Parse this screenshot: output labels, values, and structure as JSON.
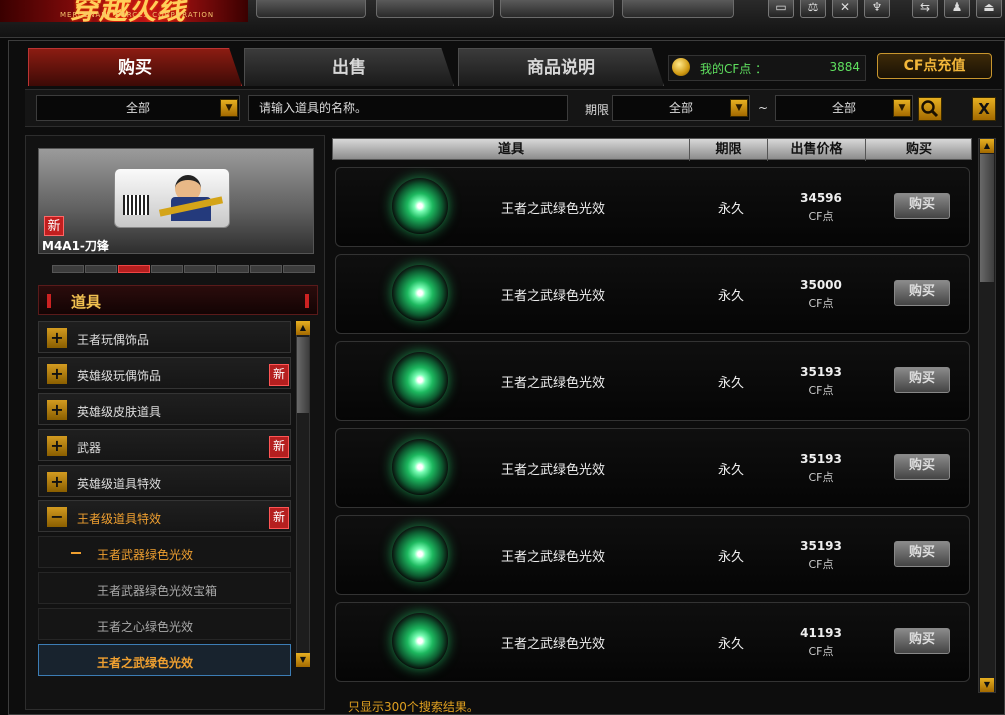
{
  "top": {
    "logo_text": "穿越火线",
    "logo_sub": "MERCENARY FORCES CORPORATION",
    "buttons": [
      "",
      "",
      "",
      ""
    ],
    "window_icons": [
      "minimize-icon",
      "scale-icon",
      "close-icon",
      "trophy-icon",
      "back-icon",
      "user-icon",
      "exit-icon"
    ]
  },
  "tabs": {
    "buy": "购买",
    "sell": "出售",
    "info": "商品说明"
  },
  "cf": {
    "label": "我的CF点 ：",
    "value": "3884",
    "recharge": "CF点充值"
  },
  "search": {
    "category": "全部",
    "placeholder": "请输入道具的名称。",
    "period_label": "期限",
    "period_from": "全部",
    "tilde": "~",
    "period_to": "全部",
    "close": "X"
  },
  "banner": {
    "new_badge": "新",
    "item_name": "M4A1-刀锋",
    "pager_count": 8,
    "pager_active": 3
  },
  "categories": {
    "header": "道具",
    "items": [
      {
        "label": "王者玩偶饰品",
        "new": ""
      },
      {
        "label": "英雄级玩偶饰品",
        "new": "新"
      },
      {
        "label": "英雄级皮肤道具",
        "new": ""
      },
      {
        "label": "武器",
        "new": "新"
      },
      {
        "label": "英雄级道具特效",
        "new": ""
      },
      {
        "label": "王者级道具特效",
        "new": "新"
      }
    ],
    "sub_header": "王者武器绿色光效",
    "sub_items": [
      "王者武器绿色光效宝箱",
      "王者之心绿色光效",
      "王者之武绿色光效"
    ]
  },
  "list": {
    "headers": [
      "道具",
      "期限",
      "出售价格",
      "购买"
    ],
    "unit": "CF点",
    "buy_label": "购买",
    "rows": [
      {
        "name": "王者之武绿色光效",
        "period": "永久",
        "price": "34596"
      },
      {
        "name": "王者之武绿色光效",
        "period": "永久",
        "price": "35000"
      },
      {
        "name": "王者之武绿色光效",
        "period": "永久",
        "price": "35193"
      },
      {
        "name": "王者之武绿色光效",
        "period": "永久",
        "price": "35193"
      },
      {
        "name": "王者之武绿色光效",
        "period": "永久",
        "price": "35193"
      },
      {
        "name": "王者之武绿色光效",
        "period": "永久",
        "price": "41193"
      }
    ]
  },
  "footer": "只显示300个搜索结果。"
}
